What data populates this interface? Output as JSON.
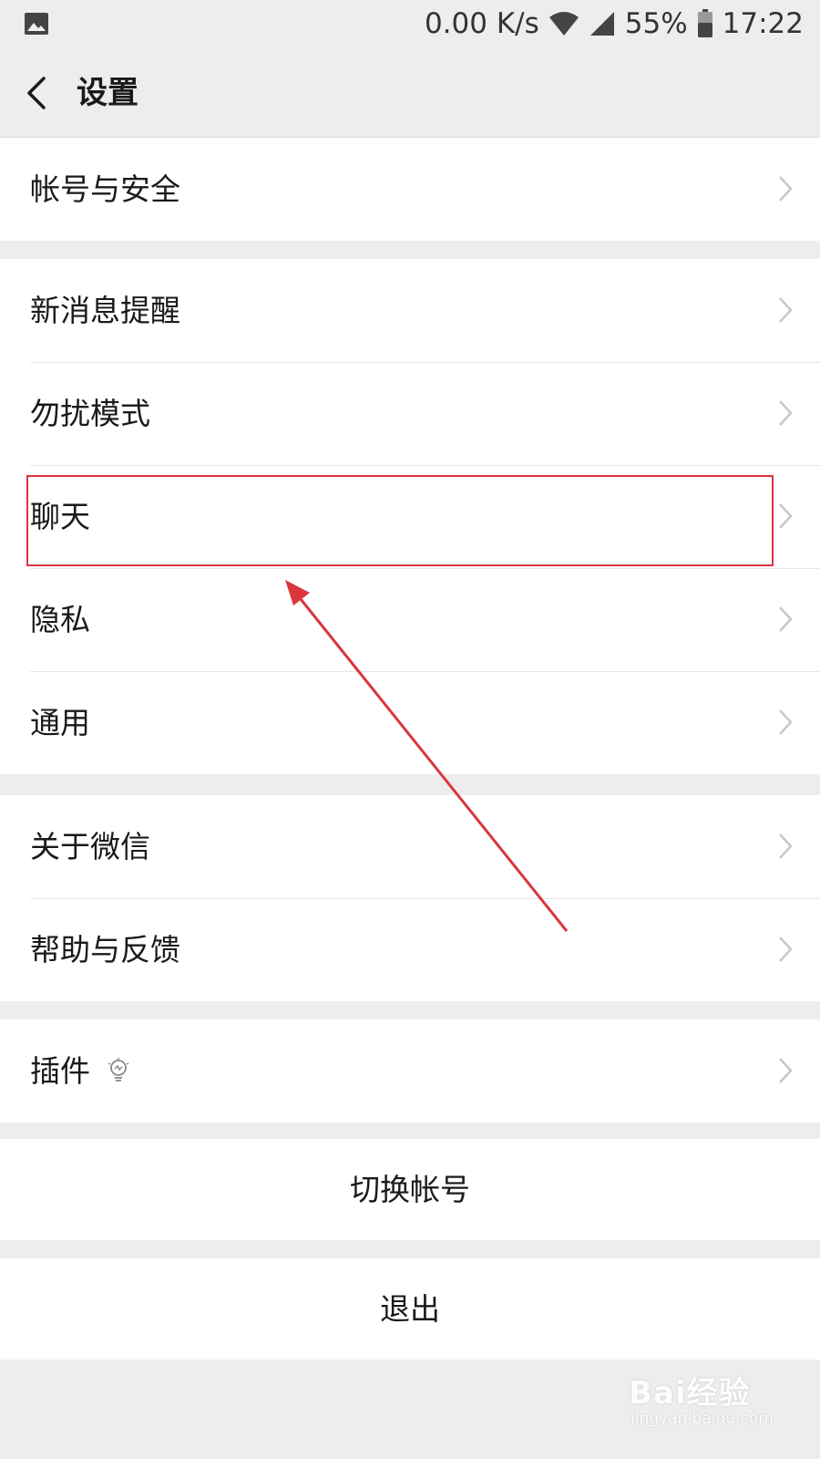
{
  "status_bar": {
    "network_speed": "0.00 K/s",
    "battery": "55%",
    "time": "17:22"
  },
  "header": {
    "title": "设置"
  },
  "groups": [
    {
      "items": [
        "帐号与安全"
      ]
    },
    {
      "items": [
        "新消息提醒",
        "勿扰模式",
        "聊天",
        "隐私",
        "通用"
      ]
    },
    {
      "items": [
        "关于微信",
        "帮助与反馈"
      ]
    },
    {
      "items": [
        "插件"
      ]
    }
  ],
  "actions": {
    "switch_account": "切换帐号",
    "logout": "退出"
  },
  "annotation": {
    "color": "#d9363e",
    "highlighted_item": "聊天"
  },
  "watermark": {
    "main": "Bai经验",
    "sub": "jingyan.baidu.com"
  }
}
